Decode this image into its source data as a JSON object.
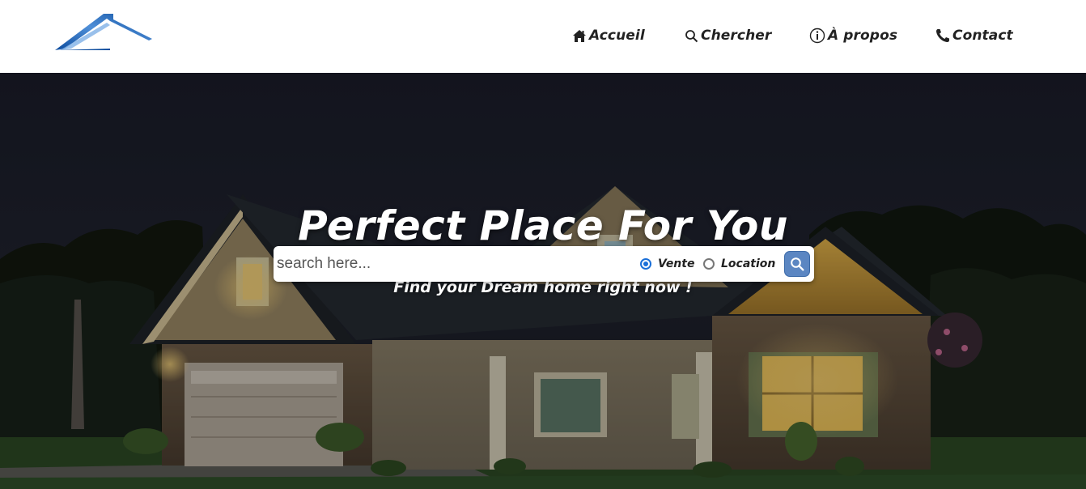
{
  "header": {
    "logo_icon": "house-roof-logo",
    "nav": [
      {
        "label": "Accueil",
        "icon": "home-icon"
      },
      {
        "label": "Chercher",
        "icon": "search-icon"
      },
      {
        "label": "À propos",
        "icon": "info-icon"
      },
      {
        "label": "Contact",
        "icon": "phone-icon"
      }
    ]
  },
  "hero": {
    "title": "Perfect Place For You",
    "subtitle": "Find your Dream home right now !",
    "background": "house-at-night-photo"
  },
  "search": {
    "placeholder": "search here...",
    "value": "",
    "options": [
      {
        "label": "Vente",
        "checked": true
      },
      {
        "label": "Location",
        "checked": false
      }
    ],
    "button_icon": "search-icon"
  },
  "colors": {
    "logo_blue": "#1f5fb4",
    "radio_accent": "#1a6fd8",
    "search_button": "#5b86c2",
    "nav_text": "#222222"
  }
}
